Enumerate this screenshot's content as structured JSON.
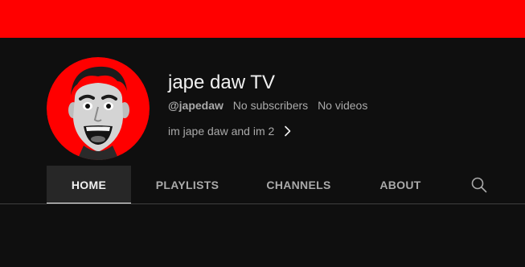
{
  "colors": {
    "banner": "#ff0000",
    "background": "#0f0f0f",
    "avatar_bg": "#ff0000"
  },
  "channel": {
    "title": "jape daw TV",
    "handle": "@japedaw",
    "subscribers": "No subscribers",
    "videos": "No videos",
    "description": "im jape daw and im 2"
  },
  "tabs": [
    {
      "label": "HOME",
      "active": true
    },
    {
      "label": "PLAYLISTS",
      "active": false
    },
    {
      "label": "CHANNELS",
      "active": false
    },
    {
      "label": "ABOUT",
      "active": false
    }
  ],
  "icons": {
    "search": "search-icon",
    "description_more": "chevron-right-icon",
    "avatar": "channel-avatar"
  }
}
